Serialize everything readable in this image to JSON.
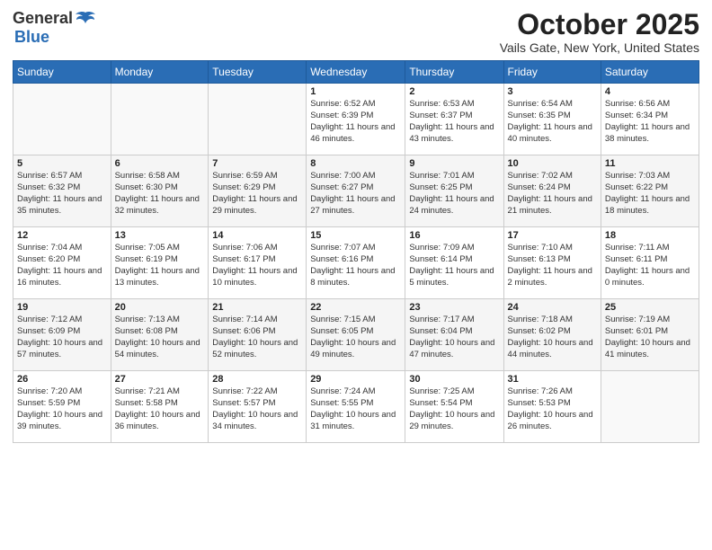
{
  "logo": {
    "general": "General",
    "blue": "Blue"
  },
  "header": {
    "month": "October 2025",
    "location": "Vails Gate, New York, United States"
  },
  "days_of_week": [
    "Sunday",
    "Monday",
    "Tuesday",
    "Wednesday",
    "Thursday",
    "Friday",
    "Saturday"
  ],
  "weeks": [
    [
      {
        "day": "",
        "content": ""
      },
      {
        "day": "",
        "content": ""
      },
      {
        "day": "",
        "content": ""
      },
      {
        "day": "1",
        "content": "Sunrise: 6:52 AM\nSunset: 6:39 PM\nDaylight: 11 hours and 46 minutes."
      },
      {
        "day": "2",
        "content": "Sunrise: 6:53 AM\nSunset: 6:37 PM\nDaylight: 11 hours and 43 minutes."
      },
      {
        "day": "3",
        "content": "Sunrise: 6:54 AM\nSunset: 6:35 PM\nDaylight: 11 hours and 40 minutes."
      },
      {
        "day": "4",
        "content": "Sunrise: 6:56 AM\nSunset: 6:34 PM\nDaylight: 11 hours and 38 minutes."
      }
    ],
    [
      {
        "day": "5",
        "content": "Sunrise: 6:57 AM\nSunset: 6:32 PM\nDaylight: 11 hours and 35 minutes."
      },
      {
        "day": "6",
        "content": "Sunrise: 6:58 AM\nSunset: 6:30 PM\nDaylight: 11 hours and 32 minutes."
      },
      {
        "day": "7",
        "content": "Sunrise: 6:59 AM\nSunset: 6:29 PM\nDaylight: 11 hours and 29 minutes."
      },
      {
        "day": "8",
        "content": "Sunrise: 7:00 AM\nSunset: 6:27 PM\nDaylight: 11 hours and 27 minutes."
      },
      {
        "day": "9",
        "content": "Sunrise: 7:01 AM\nSunset: 6:25 PM\nDaylight: 11 hours and 24 minutes."
      },
      {
        "day": "10",
        "content": "Sunrise: 7:02 AM\nSunset: 6:24 PM\nDaylight: 11 hours and 21 minutes."
      },
      {
        "day": "11",
        "content": "Sunrise: 7:03 AM\nSunset: 6:22 PM\nDaylight: 11 hours and 18 minutes."
      }
    ],
    [
      {
        "day": "12",
        "content": "Sunrise: 7:04 AM\nSunset: 6:20 PM\nDaylight: 11 hours and 16 minutes."
      },
      {
        "day": "13",
        "content": "Sunrise: 7:05 AM\nSunset: 6:19 PM\nDaylight: 11 hours and 13 minutes."
      },
      {
        "day": "14",
        "content": "Sunrise: 7:06 AM\nSunset: 6:17 PM\nDaylight: 11 hours and 10 minutes."
      },
      {
        "day": "15",
        "content": "Sunrise: 7:07 AM\nSunset: 6:16 PM\nDaylight: 11 hours and 8 minutes."
      },
      {
        "day": "16",
        "content": "Sunrise: 7:09 AM\nSunset: 6:14 PM\nDaylight: 11 hours and 5 minutes."
      },
      {
        "day": "17",
        "content": "Sunrise: 7:10 AM\nSunset: 6:13 PM\nDaylight: 11 hours and 2 minutes."
      },
      {
        "day": "18",
        "content": "Sunrise: 7:11 AM\nSunset: 6:11 PM\nDaylight: 11 hours and 0 minutes."
      }
    ],
    [
      {
        "day": "19",
        "content": "Sunrise: 7:12 AM\nSunset: 6:09 PM\nDaylight: 10 hours and 57 minutes."
      },
      {
        "day": "20",
        "content": "Sunrise: 7:13 AM\nSunset: 6:08 PM\nDaylight: 10 hours and 54 minutes."
      },
      {
        "day": "21",
        "content": "Sunrise: 7:14 AM\nSunset: 6:06 PM\nDaylight: 10 hours and 52 minutes."
      },
      {
        "day": "22",
        "content": "Sunrise: 7:15 AM\nSunset: 6:05 PM\nDaylight: 10 hours and 49 minutes."
      },
      {
        "day": "23",
        "content": "Sunrise: 7:17 AM\nSunset: 6:04 PM\nDaylight: 10 hours and 47 minutes."
      },
      {
        "day": "24",
        "content": "Sunrise: 7:18 AM\nSunset: 6:02 PM\nDaylight: 10 hours and 44 minutes."
      },
      {
        "day": "25",
        "content": "Sunrise: 7:19 AM\nSunset: 6:01 PM\nDaylight: 10 hours and 41 minutes."
      }
    ],
    [
      {
        "day": "26",
        "content": "Sunrise: 7:20 AM\nSunset: 5:59 PM\nDaylight: 10 hours and 39 minutes."
      },
      {
        "day": "27",
        "content": "Sunrise: 7:21 AM\nSunset: 5:58 PM\nDaylight: 10 hours and 36 minutes."
      },
      {
        "day": "28",
        "content": "Sunrise: 7:22 AM\nSunset: 5:57 PM\nDaylight: 10 hours and 34 minutes."
      },
      {
        "day": "29",
        "content": "Sunrise: 7:24 AM\nSunset: 5:55 PM\nDaylight: 10 hours and 31 minutes."
      },
      {
        "day": "30",
        "content": "Sunrise: 7:25 AM\nSunset: 5:54 PM\nDaylight: 10 hours and 29 minutes."
      },
      {
        "day": "31",
        "content": "Sunrise: 7:26 AM\nSunset: 5:53 PM\nDaylight: 10 hours and 26 minutes."
      },
      {
        "day": "",
        "content": ""
      }
    ]
  ]
}
